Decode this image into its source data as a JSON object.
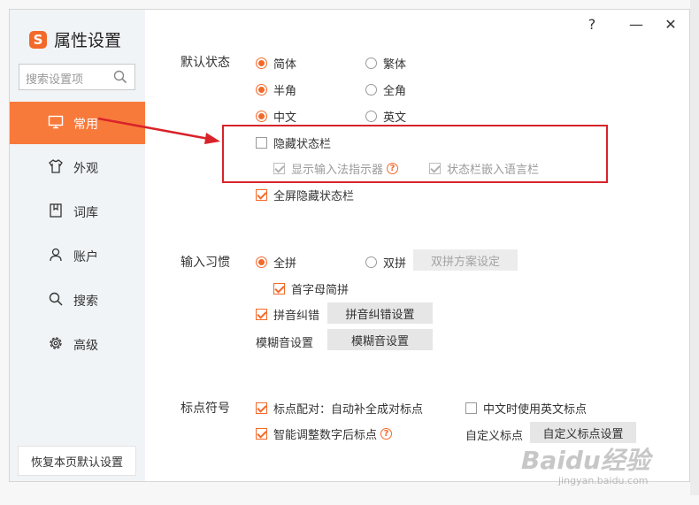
{
  "window": {
    "title": "属性设置",
    "logo_letter": "S",
    "help_glyph": "?",
    "minimize_glyph": "—",
    "close_glyph": "✕"
  },
  "sidebar": {
    "search_placeholder": "搜索设置项",
    "items": [
      {
        "label": "常用",
        "icon": "monitor-icon",
        "active": true
      },
      {
        "label": "外观",
        "icon": "shirt-icon"
      },
      {
        "label": "词库",
        "icon": "book-icon"
      },
      {
        "label": "账户",
        "icon": "user-icon"
      },
      {
        "label": "搜索",
        "icon": "search-icon"
      },
      {
        "label": "高级",
        "icon": "gear-icon"
      }
    ],
    "restore_label": "恢复本页默认设置"
  },
  "default_state": {
    "label": "默认状态",
    "simplified": "简体",
    "traditional": "繁体",
    "half_width": "半角",
    "full_width": "全角",
    "chinese": "中文",
    "english": "英文",
    "hide_status_bar": "隐藏状态栏",
    "show_ime_indicator": "显示输入法指示器",
    "status_bar_embed_lang": "状态栏嵌入语言栏",
    "fullscreen_hide_status_bar": "全屏隐藏状态栏"
  },
  "input_habits": {
    "label": "输入习惯",
    "full_pinyin": "全拼",
    "double_pinyin": "双拼",
    "double_pinyin_settings": "双拼方案设定",
    "initial_abbrev": "首字母简拼",
    "pinyin_correction": "拼音纠错",
    "pinyin_correction_settings": "拼音纠错设置",
    "fuzzy_settings_label": "模糊音设置",
    "fuzzy_settings_button": "模糊音设置"
  },
  "punctuation": {
    "label": "标点符号",
    "auto_pair": "标点配对：自动补全成对标点",
    "english_punct_in_chinese": "中文时使用英文标点",
    "smart_adjust": "智能调整数字后标点",
    "custom_label": "自定义标点",
    "custom_button": "自定义标点设置"
  },
  "watermark": {
    "text": "Baidu经验",
    "url": "jingyan.baidu.com"
  },
  "colors": {
    "accent": "#f3692a",
    "sidebar_active": "#f87a3b",
    "annotation_red": "#d8232a"
  }
}
